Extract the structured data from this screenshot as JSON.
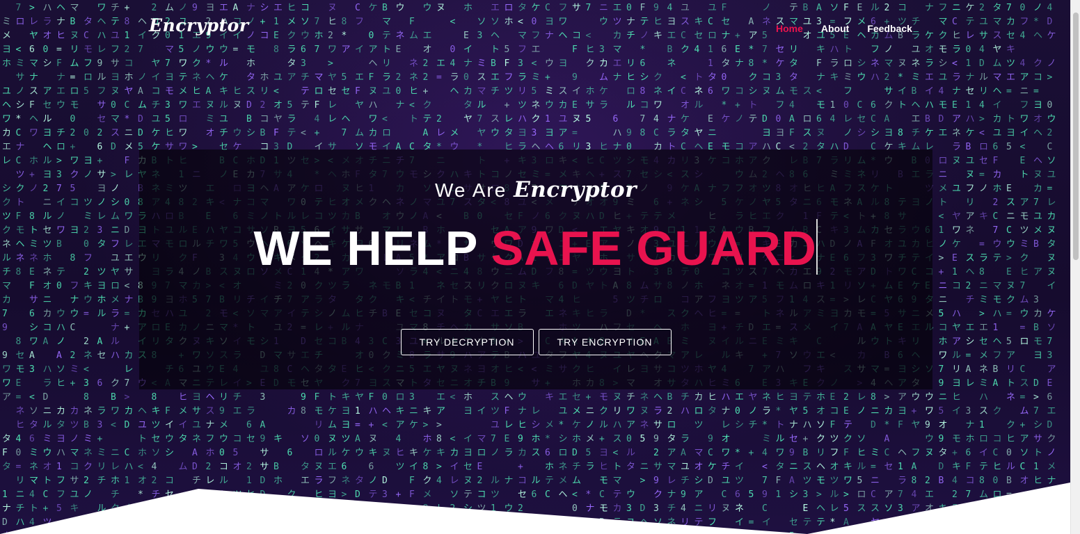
{
  "nav": {
    "brand": "Encryptor",
    "items": [
      {
        "label": "Home",
        "active": true
      },
      {
        "label": "About",
        "active": false
      },
      {
        "label": "Feedback",
        "active": false
      }
    ]
  },
  "hero": {
    "subtitle_prefix": "We Are",
    "subtitle_brand": "Encryptor",
    "headline_white": "WE HELP",
    "headline_accent": "SAFE GUARD",
    "buttons": {
      "decrypt_label": "TRY DECRYPTION",
      "encrypt_label": "TRY ENCRYPTION"
    }
  },
  "colors": {
    "accent": "#e8134e",
    "matrix_glyph": "#58f0c0",
    "matrix_background": "#170c30",
    "text": "#ffffff"
  }
}
